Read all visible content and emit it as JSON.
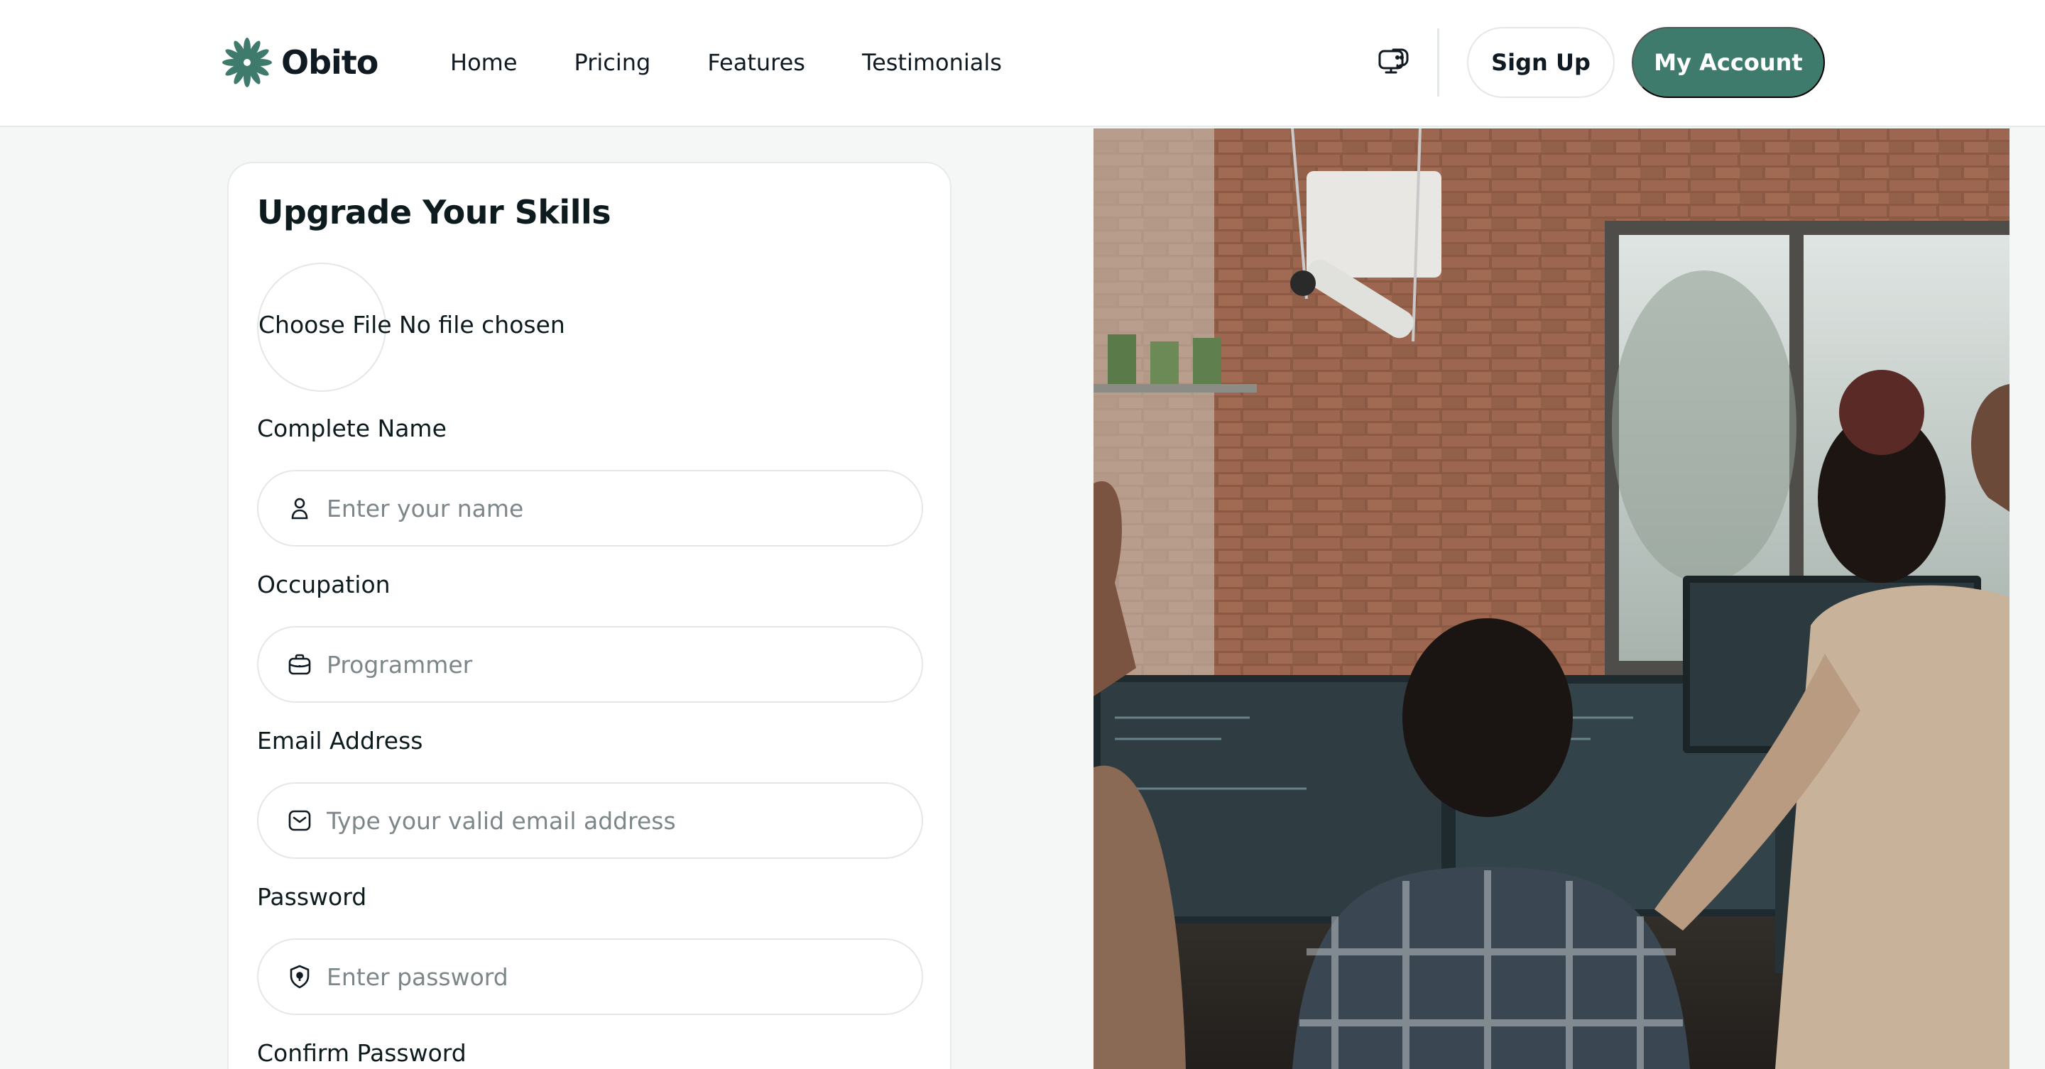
{
  "brand": {
    "name": "Obito",
    "accent_color": "#3f7b6c"
  },
  "nav": {
    "items": [
      {
        "label": "Home"
      },
      {
        "label": "Pricing"
      },
      {
        "label": "Features"
      },
      {
        "label": "Testimonials"
      }
    ]
  },
  "header": {
    "chat_icon": "chat-support-icon",
    "signup_label": "Sign Up",
    "account_label": "My Account"
  },
  "form": {
    "title": "Upgrade Your Skills",
    "file_picker": {
      "button_label": "Choose File",
      "status": "No file chosen"
    },
    "fields": [
      {
        "label": "Complete Name",
        "placeholder": "Enter your name",
        "icon": "user-icon",
        "value": ""
      },
      {
        "label": "Occupation",
        "placeholder": "Programmer",
        "icon": "briefcase-icon",
        "value": ""
      },
      {
        "label": "Email Address",
        "placeholder": "Type your valid email address",
        "icon": "mail-icon",
        "value": ""
      },
      {
        "label": "Password",
        "placeholder": "Enter password",
        "icon": "shield-icon",
        "value": ""
      }
    ],
    "confirm_password_label": "Confirm Password"
  },
  "hero_image": {
    "subject": "team-working-at-computers-photo"
  }
}
